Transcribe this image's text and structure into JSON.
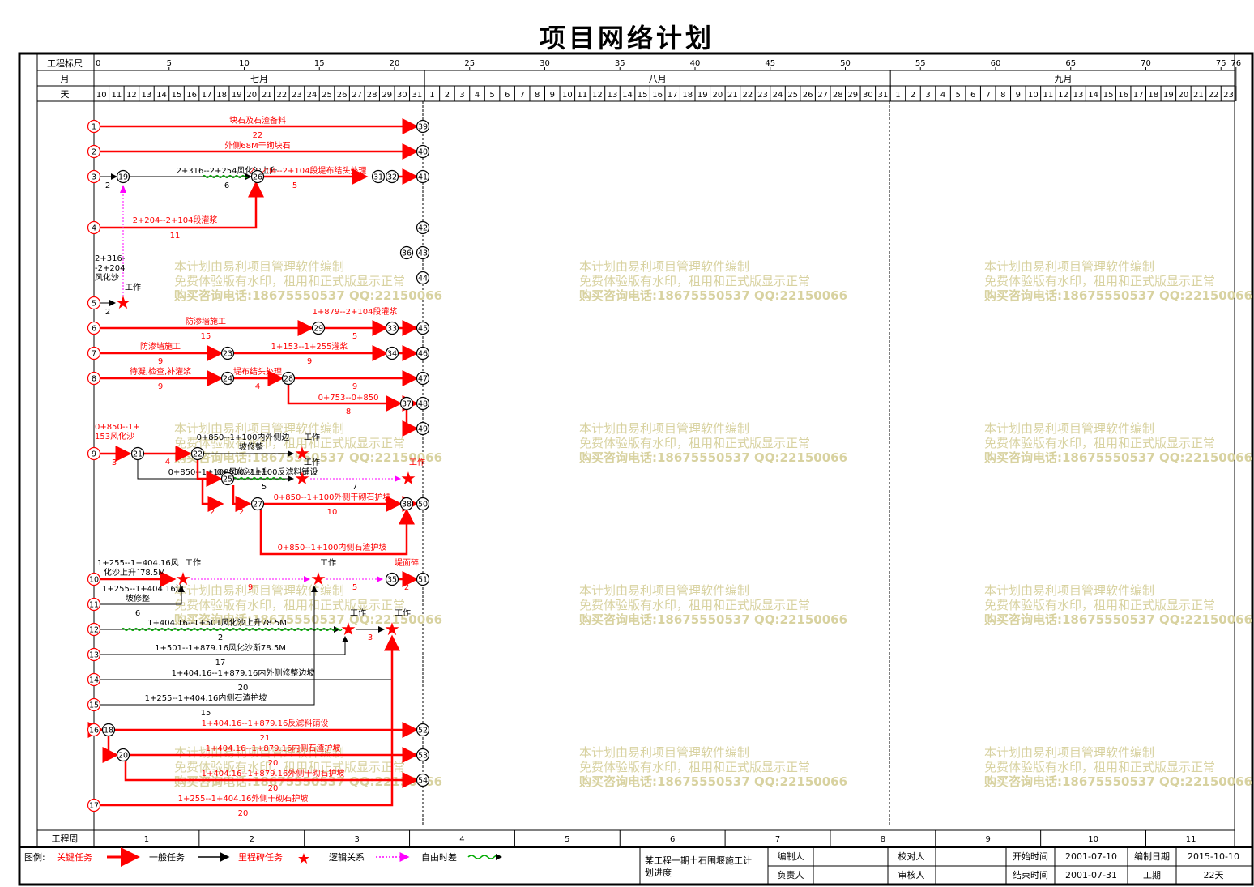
{
  "title": "项目网络计划",
  "header": {
    "scale_label": "工程标尺",
    "month_label": "月",
    "day_label": "天",
    "scale_ticks": [
      "0",
      "5",
      "10",
      "15",
      "20",
      "25",
      "30",
      "35",
      "40",
      "45",
      "50",
      "55",
      "60",
      "65",
      "70",
      "75",
      "76"
    ],
    "months": [
      "七月",
      "八月",
      "九月"
    ],
    "days_jul": [
      "10",
      "11",
      "12",
      "13",
      "14",
      "15",
      "16",
      "17",
      "18",
      "19",
      "20",
      "21",
      "22",
      "23",
      "24",
      "25",
      "26",
      "27",
      "28",
      "29",
      "30",
      "31"
    ],
    "days_aug": [
      "1",
      "2",
      "3",
      "4",
      "5",
      "6",
      "7",
      "8",
      "9",
      "10",
      "11",
      "12",
      "13",
      "14",
      "15",
      "16",
      "17",
      "18",
      "19",
      "20",
      "21",
      "22",
      "23",
      "24",
      "25",
      "26",
      "27",
      "28",
      "29",
      "30",
      "31"
    ],
    "days_sep": [
      "1",
      "2",
      "3",
      "4",
      "5",
      "6",
      "7",
      "8",
      "9",
      "10",
      "11",
      "12",
      "13",
      "14",
      "15",
      "16",
      "17",
      "18",
      "19",
      "20",
      "21",
      "22",
      "23"
    ]
  },
  "week_label": "工程周",
  "weeks": [
    "1",
    "2",
    "3",
    "4",
    "5",
    "6",
    "7",
    "8",
    "9",
    "10",
    "11"
  ],
  "watermark": [
    "本计划由易利项目管理软件编制",
    "免费体验版有水印，租用和正式版显示正常",
    "购买咨询电话:18675550537 QQ:22150066"
  ],
  "legend": {
    "label": "图例:",
    "critical": "关键任务",
    "normal": "一般任务",
    "milestone": "里程碑任务",
    "logic": "逻辑关系",
    "float": "自由时差"
  },
  "footer": {
    "project_name": "某工程一期土石围堰施工计划进度",
    "editor_label": "编制人",
    "owner_label": "负责人",
    "checker_label": "校对人",
    "reviewer_label": "审核人",
    "start_label": "开始时间",
    "start_value": "2001-07-10",
    "end_label": "结束时间",
    "end_value": "2001-07-31",
    "date_label": "编制日期",
    "date_value": "2015-10-10",
    "period_label": "工期",
    "period_value": "22天"
  },
  "colors": {
    "critical": "#ff0000",
    "normal": "#000000",
    "logic": "#ff00ff",
    "float": "#00aa00",
    "watermark": "#d8d2a0"
  },
  "chart_data": {
    "type": "network",
    "x_unit": "day",
    "xlim": [
      0,
      76
    ],
    "nodes": [
      {
        "id": "1",
        "day": 0,
        "row": 1
      },
      {
        "id": "2",
        "day": 0,
        "row": 2
      },
      {
        "id": "3",
        "day": 0,
        "row": 3
      },
      {
        "id": "4",
        "day": 0,
        "row": 4
      },
      {
        "id": "5",
        "day": 0,
        "row": 5
      },
      {
        "id": "6",
        "day": 0,
        "row": 6
      },
      {
        "id": "7",
        "day": 0,
        "row": 7
      },
      {
        "id": "8",
        "day": 0,
        "row": 8
      },
      {
        "id": "9",
        "day": 0,
        "row": 9
      },
      {
        "id": "10",
        "day": 0,
        "row": 10
      },
      {
        "id": "11",
        "day": 0,
        "row": 11
      },
      {
        "id": "12",
        "day": 0,
        "row": 12
      },
      {
        "id": "13",
        "day": 0,
        "row": 13
      },
      {
        "id": "14",
        "day": 0,
        "row": 14
      },
      {
        "id": "15",
        "day": 0,
        "row": 15
      },
      {
        "id": "16",
        "day": 0,
        "row": 16
      },
      {
        "id": "17",
        "day": 0,
        "row": 17
      },
      {
        "id": "19",
        "day": 2
      },
      {
        "id": "26",
        "day": 11
      },
      {
        "id": "31",
        "day": 19
      },
      {
        "id": "32",
        "day": 20
      },
      {
        "id": "29",
        "day": 15
      },
      {
        "id": "33",
        "day": 20
      },
      {
        "id": "23",
        "day": 9
      },
      {
        "id": "34",
        "day": 20
      },
      {
        "id": "24",
        "day": 9
      },
      {
        "id": "28",
        "day": 13
      },
      {
        "id": "37",
        "day": 21
      },
      {
        "id": "21",
        "day": 3
      },
      {
        "id": "22",
        "day": 7
      },
      {
        "id": "25",
        "day": 9
      },
      {
        "id": "27",
        "day": 11
      },
      {
        "id": "38",
        "day": 21
      },
      {
        "id": "35",
        "day": 20
      },
      {
        "id": "18",
        "day": 1
      },
      {
        "id": "20",
        "day": 2
      },
      {
        "id": "39",
        "day": 22
      },
      {
        "id": "40",
        "day": 22
      },
      {
        "id": "41",
        "day": 22
      },
      {
        "id": "42",
        "day": 22
      },
      {
        "id": "43",
        "day": 22
      },
      {
        "id": "44",
        "day": 22
      },
      {
        "id": "45",
        "day": 22
      },
      {
        "id": "46",
        "day": 22
      },
      {
        "id": "47",
        "day": 22
      },
      {
        "id": "48",
        "day": 22
      },
      {
        "id": "49",
        "day": 22
      },
      {
        "id": "50",
        "day": 22
      },
      {
        "id": "51",
        "day": 22
      },
      {
        "id": "52",
        "day": 22
      },
      {
        "id": "53",
        "day": 22
      },
      {
        "id": "54",
        "day": 22
      },
      {
        "id": "36",
        "day": 21
      }
    ],
    "tasks": [
      {
        "from": "1",
        "to": "39",
        "name": "块石及石渣备料",
        "duration": 22,
        "critical": true
      },
      {
        "from": "2",
        "to": "40",
        "name": "外侧68M干砌块石",
        "duration": "",
        "critical": true
      },
      {
        "from": "3",
        "to": "19",
        "name": "",
        "duration": 2,
        "critical": false
      },
      {
        "from": "19",
        "to": "26",
        "name": "2+316--2+254风化沙上升",
        "duration": 6,
        "critical": false
      },
      {
        "from": "26",
        "to": "31",
        "name": "2+204--2+104段堤布结头处理",
        "duration": 5,
        "critical": true
      },
      {
        "from": "4",
        "to": "26",
        "name": "2+204--2+104段灌浆",
        "duration": 11,
        "critical": true
      },
      {
        "from": "6",
        "to": "29",
        "name": "防渗墙施工",
        "duration": 15,
        "critical": true
      },
      {
        "from": "29",
        "to": "33",
        "name": "1+879--2+104段灌浆",
        "duration": 5,
        "critical": true
      },
      {
        "from": "7",
        "to": "23",
        "name": "防渗墙施工",
        "duration": 9,
        "critical": true
      },
      {
        "from": "23",
        "to": "34",
        "name": "1+153--1+255灌浆",
        "duration": 9,
        "critical": true
      },
      {
        "from": "8",
        "to": "24",
        "name": "待凝,检查,补灌浆",
        "duration": 9,
        "critical": true
      },
      {
        "from": "24",
        "to": "28",
        "name": "堤布结头处理",
        "duration": 4,
        "critical": true
      },
      {
        "from": "28",
        "to": "37",
        "name": "0+753--0+850",
        "duration": 8,
        "critical": true
      },
      {
        "from": "9",
        "to": "21",
        "name": "0+850--1+153风化沙上升76M",
        "duration": 3,
        "critical": true
      },
      {
        "from": "21",
        "to": "22",
        "name": "",
        "duration": 4,
        "critical": true
      },
      {
        "from": "25",
        "to": "38",
        "name": "0+850--1+100反滤料铺设",
        "duration": 7,
        "critical": false
      },
      {
        "from": "27",
        "to": "38",
        "name": "0+850--1+100外侧干砌石护坡",
        "duration": 10,
        "critical": true
      },
      {
        "from": "27",
        "to": "50",
        "name": "0+850--1+100内侧石渣护坡",
        "duration": "",
        "critical": true
      },
      {
        "from": "10",
        "to": "35",
        "name": "1+255--1+404.16风化沙上升78.5M",
        "duration": 9,
        "critical": true
      },
      {
        "from": "11",
        "to": "",
        "name": "1+255--1+404.16边坡修整",
        "duration": 6,
        "critical": false
      },
      {
        "from": "12",
        "to": "",
        "name": "1+404.16--1+501风化沙上升78.5M",
        "duration": 2,
        "critical": false
      },
      {
        "from": "13",
        "to": "",
        "name": "1+501--1+879.16风化沙渐78.5M",
        "duration": 17,
        "critical": false
      },
      {
        "from": "14",
        "to": "",
        "name": "1+404.16--1+879.16内外侧修整边坡",
        "duration": 20,
        "critical": false
      },
      {
        "from": "15",
        "to": "",
        "name": "1+255--1+404.16内侧石渣护坡",
        "duration": 15,
        "critical": false
      },
      {
        "from": "18",
        "to": "52",
        "name": "1+404.16--1+879.16反滤料铺设",
        "duration": 21,
        "critical": true
      },
      {
        "from": "20",
        "to": "53",
        "name": "1+404.16--1+879.16内侧石渣护坡",
        "duration": 20,
        "critical": true
      },
      {
        "from": "20",
        "to": "54",
        "name": "1+404.16--1+879.16外侧干砌石护坡",
        "duration": 20,
        "critical": true
      },
      {
        "from": "17",
        "to": "54",
        "name": "1+255--1+404.16外侧干砌石护坡",
        "duration": 20,
        "critical": true
      }
    ]
  }
}
